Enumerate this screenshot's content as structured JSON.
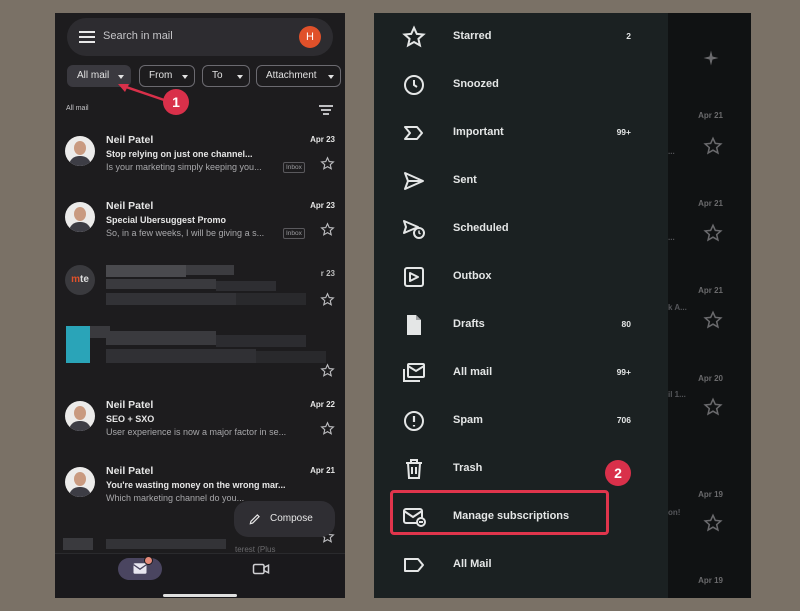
{
  "left_phone": {
    "search_placeholder": "Search in mail",
    "avatar_initial": "H",
    "chips": [
      {
        "label": "All mail",
        "active": true
      },
      {
        "label": "From",
        "active": false
      },
      {
        "label": "To",
        "active": false
      },
      {
        "label": "Attachment",
        "active": false
      }
    ],
    "folder_label": "All mail",
    "emails": [
      {
        "sender": "Neil Patel",
        "date": "Apr 23",
        "subject": "Stop relying on just one channel...",
        "snippet": "Is your marketing simply keeping you...",
        "badge": "Inbox"
      },
      {
        "sender": "Neil Patel",
        "date": "Apr 23",
        "subject": "Special Ubersuggest Promo",
        "snippet": "So, in a few weeks, I will be giving a s...",
        "badge": "Inbox"
      },
      {
        "sender": "Neil Patel",
        "date": "Apr 22",
        "subject": "SEO + SXO",
        "snippet": "User experience is now a major factor in se...",
        "badge": ""
      },
      {
        "sender": "Neil Patel",
        "date": "Apr 21",
        "subject": "You're wasting money on the wrong mar...",
        "snippet": "Which marketing channel do you...",
        "badge": ""
      }
    ],
    "blurred_date": "r 23",
    "blurred_avatar_text_a": "m",
    "blurred_avatar_text_b": "te",
    "blurred_bottom_text": "terest (Plus",
    "compose_label": "Compose",
    "mail_tab_count_dot": true
  },
  "annotations": {
    "step_one": "1",
    "step_two": "2"
  },
  "right_phone": {
    "drawer_items": [
      {
        "label": "Starred",
        "count": "2",
        "icon": "star-outline-icon"
      },
      {
        "label": "Snoozed",
        "count": "",
        "icon": "clock-icon"
      },
      {
        "label": "Important",
        "count": "99+",
        "icon": "important-label-icon"
      },
      {
        "label": "Sent",
        "count": "",
        "icon": "send-icon"
      },
      {
        "label": "Scheduled",
        "count": "",
        "icon": "scheduled-send-icon"
      },
      {
        "label": "Outbox",
        "count": "",
        "icon": "outbox-icon"
      },
      {
        "label": "Drafts",
        "count": "80",
        "icon": "draft-icon"
      },
      {
        "label": "All mail",
        "count": "99+",
        "icon": "all-mail-icon"
      },
      {
        "label": "Spam",
        "count": "706",
        "icon": "spam-icon"
      },
      {
        "label": "Trash",
        "count": "",
        "icon": "trash-icon"
      },
      {
        "label": "Manage subscriptions",
        "count": "",
        "icon": "manage-subscriptions-icon"
      },
      {
        "label": "All Mail",
        "count": "",
        "icon": "label-icon"
      }
    ],
    "background_dates": [
      "Apr 21",
      "Apr 21",
      "Apr 21",
      "Apr 20",
      "Apr 19",
      "Apr 19"
    ],
    "background_snippets": [
      "...",
      "...",
      "k A...",
      "il 1...",
      "on!",
      ""
    ],
    "accent_highlight": "#e0354c"
  }
}
